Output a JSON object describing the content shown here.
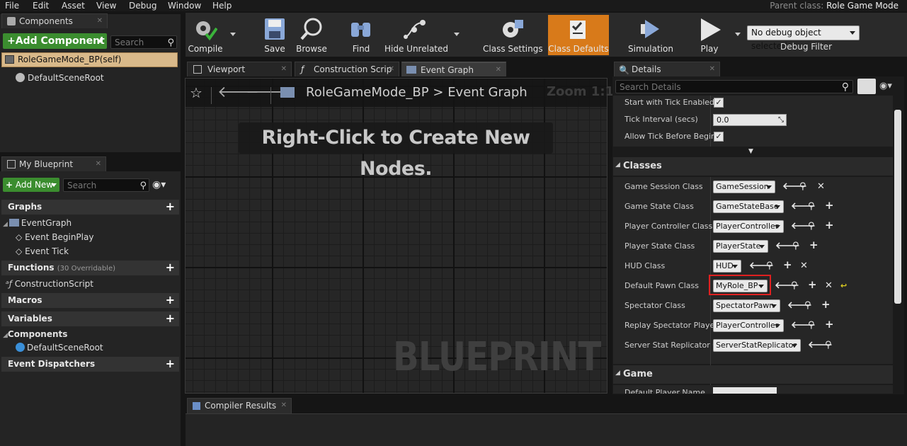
{
  "menu": [
    "File",
    "Edit",
    "Asset",
    "View",
    "Debug",
    "Window",
    "Help"
  ],
  "parent_class": {
    "label": "Parent class:",
    "value": "Role Game Mode"
  },
  "toolbar": {
    "compile": "Compile",
    "save": "Save",
    "browse": "Browse",
    "find": "Find",
    "hide_unrelated": "Hide Unrelated",
    "class_settings": "Class Settings",
    "class_defaults": "Class Defaults",
    "simulation": "Simulation",
    "play": "Play",
    "debug_select": "No debug object selected",
    "debug_filter": "Debug Filter"
  },
  "components_panel": {
    "tab": "Components",
    "add_button": "+Add Component",
    "search_placeholder": "Search",
    "self_item": "RoleGameMode_BP(self)",
    "root_item": "DefaultSceneRoot"
  },
  "my_blueprint": {
    "tab": "My Blueprint",
    "add_new": "Add New",
    "search_placeholder": "Search",
    "graphs": "Graphs",
    "event_graph": "EventGraph",
    "event_begin": "Event BeginPlay",
    "event_tick": "Event Tick",
    "functions": "Functions",
    "functions_note": "(30 Overridable)",
    "construction": "ConstructionScript",
    "macros": "Macros",
    "variables": "Variables",
    "components": "Components",
    "default_root": "DefaultSceneRoot",
    "event_dispatchers": "Event Dispatchers"
  },
  "editor_tabs": {
    "viewport": "Viewport",
    "construction": "Construction Scrip",
    "event_graph": "Event Graph"
  },
  "graph": {
    "breadcrumb_bp": "RoleGameMode_BP",
    "breadcrumb_sep": ">",
    "breadcrumb_graph": "Event Graph",
    "zoom": "Zoom 1:1",
    "hint": "Right-Click to Create New Nodes.",
    "watermark": "BLUEPRINT"
  },
  "details": {
    "tab": "Details",
    "search_placeholder": "Search Details",
    "start_tick": "Start with Tick Enabled",
    "tick_interval": "Tick Interval (secs)",
    "tick_value": "0.0",
    "allow_tick": "Allow Tick Before Begin",
    "classes_section": "Classes",
    "game_section": "Game",
    "game_partial": "Default Player Name",
    "rows": [
      {
        "label": "Game Session Class",
        "value": "GameSession"
      },
      {
        "label": "Game State Class",
        "value": "GameStateBase"
      },
      {
        "label": "Player Controller Class",
        "value": "PlayerController"
      },
      {
        "label": "Player State Class",
        "value": "PlayerState"
      },
      {
        "label": "HUD Class",
        "value": "HUD"
      },
      {
        "label": "Default Pawn Class",
        "value": "MyRole_BP"
      },
      {
        "label": "Spectator Class",
        "value": "SpectatorPawn"
      },
      {
        "label": "Replay Spectator Player",
        "value": "PlayerController"
      },
      {
        "label": "Server Stat Replicator C",
        "value": "ServerStatReplicator"
      }
    ]
  },
  "compiler": {
    "tab": "Compiler Results"
  },
  "colors": {
    "accent_orange": "#d87a1a",
    "green": "#3b8d2f",
    "highlight_red": "#e02020"
  }
}
